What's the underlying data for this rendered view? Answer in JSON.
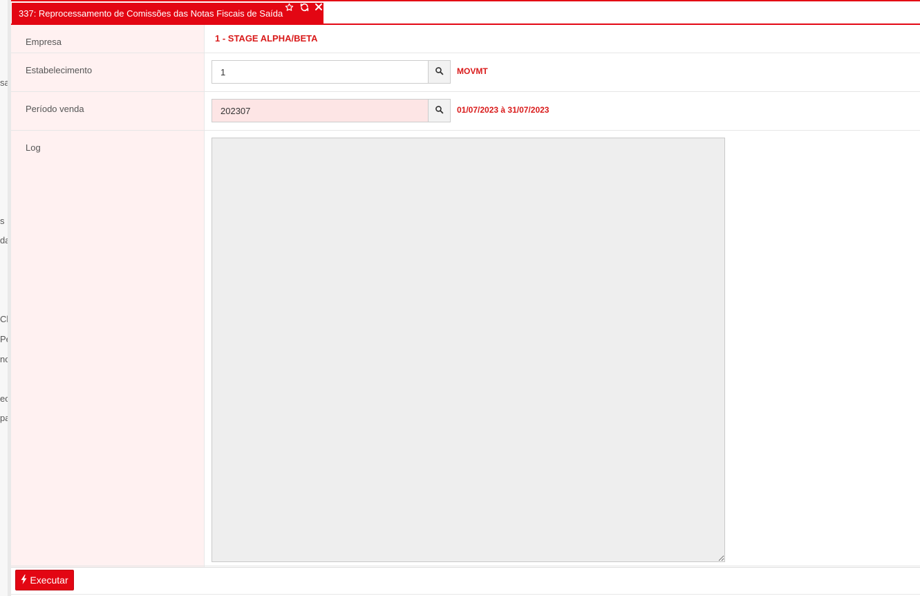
{
  "sidebar_fragments": [
    "sa",
    "s",
    "da",
    "Ch",
    "Pe",
    "no",
    "ec",
    "pa"
  ],
  "tab": {
    "title": "337: Reprocessamento de Comissões das Notas Fiscais de Saída",
    "icons": [
      "star-outline-icon",
      "refresh-icon",
      "close-icon"
    ]
  },
  "form": {
    "empresa": {
      "label": "Empresa",
      "value": "1 - STAGE ALPHA/BETA"
    },
    "estabelecimento": {
      "label": "Estabelecimento",
      "input_value": "1",
      "description": "MOVMT"
    },
    "periodo": {
      "label": "Período venda",
      "input_value": "202307",
      "description": "01/07/2023 à 31/07/2023"
    },
    "log": {
      "label": "Log",
      "value": ""
    }
  },
  "actions": {
    "executar_label": "Executar"
  },
  "colors": {
    "accent": "#e30613",
    "label_bg": "#fff1f1",
    "value_text": "#d91a1a",
    "required_input_bg": "#fde5e5",
    "log_bg": "#eeeeee"
  }
}
